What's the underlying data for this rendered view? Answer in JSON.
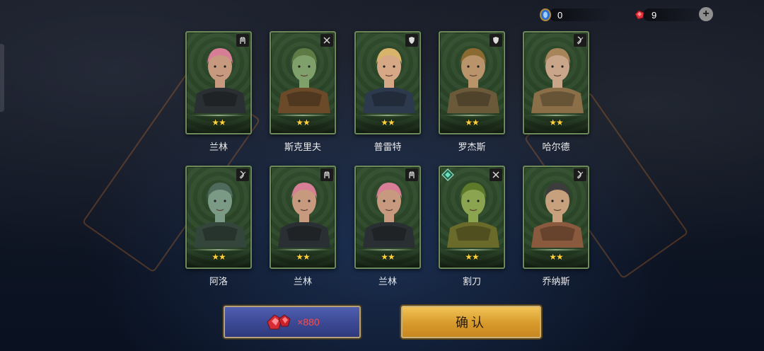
{
  "resources": {
    "crystal_count": "0",
    "ruby_count": "9",
    "crystal_icon": "blue-crystal-icon",
    "ruby_icon": "red-gem-icon",
    "add_icon": "plus-icon"
  },
  "heroes": [
    {
      "name": "兰林",
      "stars": 2,
      "class_icon": "hands-icon"
    },
    {
      "name": "斯克里夫",
      "stars": 2,
      "class_icon": "crossed-swords-icon"
    },
    {
      "name": "普雷特",
      "stars": 2,
      "class_icon": "shield-icon"
    },
    {
      "name": "罗杰斯",
      "stars": 2,
      "class_icon": "shield-icon"
    },
    {
      "name": "哈尔德",
      "stars": 2,
      "class_icon": "bow-icon"
    },
    {
      "name": "阿洛",
      "stars": 2,
      "class_icon": "bow-icon"
    },
    {
      "name": "兰林",
      "stars": 2,
      "class_icon": "hands-icon"
    },
    {
      "name": "兰林",
      "stars": 2,
      "class_icon": "hands-icon"
    },
    {
      "name": "割刀",
      "stars": 2,
      "class_icon": "crossed-swords-icon",
      "badge_icon": "green-gem-icon"
    },
    {
      "name": "乔纳斯",
      "stars": 2,
      "class_icon": "bow-icon"
    }
  ],
  "buttons": {
    "cost_label": "×880",
    "confirm_label": "确认"
  },
  "colors": {
    "star": "#ffd23a",
    "card_border": "#6d8a5a",
    "confirm_bg": "#e0a73a",
    "cost_bg": "#3f4c9a",
    "cost_text": "#ff4b4b"
  }
}
